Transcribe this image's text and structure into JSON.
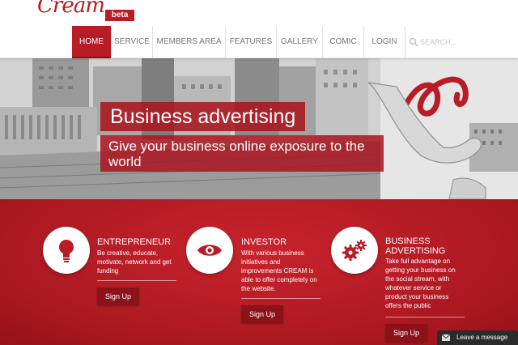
{
  "brand": {
    "logo": "Cream",
    "badge": "beta"
  },
  "nav": {
    "items": [
      {
        "label": "HOME",
        "active": true
      },
      {
        "label": "SERVICE"
      },
      {
        "label": "MEMBERS AREA"
      },
      {
        "label": "FEATURES"
      },
      {
        "label": "GALLERY"
      },
      {
        "label": "COMIC"
      },
      {
        "label": "LOGIN"
      }
    ],
    "search_placeholder": "SEARCH..."
  },
  "hero": {
    "title": "Business advertising",
    "subtitle": "Give your business online exposure to the world"
  },
  "features": [
    {
      "icon": "lightbulb-icon",
      "title": "ENTREPRENEUR",
      "text": "Be creative, educate, motivate, network and get funding",
      "button": "Sign Up"
    },
    {
      "icon": "eye-icon",
      "title": "INVESTOR",
      "text": "With various business initiatives and improvements CREAM is able to offer completely on the website.",
      "button": "Sign Up"
    },
    {
      "icon": "gears-icon",
      "title": "BUSINESS ADVERTISING",
      "text": "Take full advantage on getting your business on the social stream, with whatever service or product your business offers the public",
      "button": "Sign Up"
    }
  ],
  "chat": {
    "label": "Leave a message"
  },
  "colors": {
    "brand_red": "#b81c24",
    "button_dark_red": "#8c1219"
  }
}
